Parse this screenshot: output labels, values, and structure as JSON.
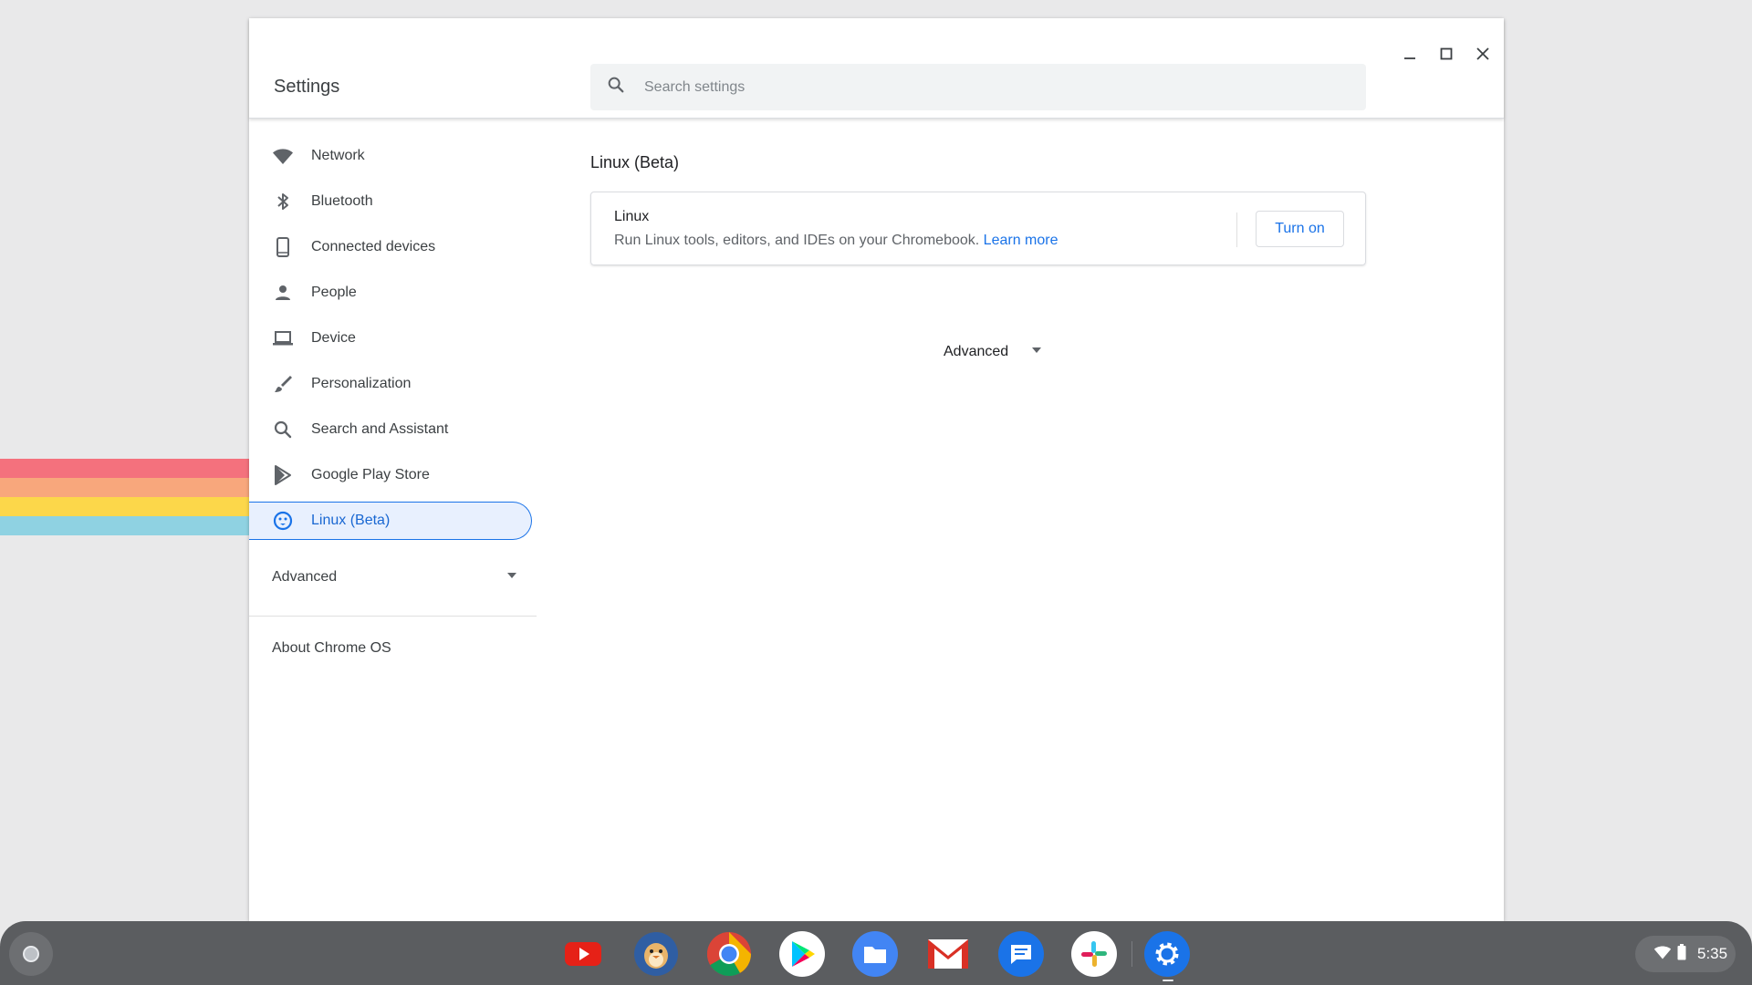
{
  "wallpaper": {
    "stripe_colors": [
      "#f4717d",
      "#f8a77c",
      "#fcd74a",
      "#8fd2e2"
    ]
  },
  "window": {
    "title": "Settings",
    "controls": {
      "minimize": "minimize-icon",
      "maximize": "maximize-icon",
      "close": "close-icon"
    }
  },
  "search": {
    "placeholder": "Search settings",
    "value": ""
  },
  "sidebar": {
    "items": [
      {
        "label": "Network",
        "icon": "wifi-icon"
      },
      {
        "label": "Bluetooth",
        "icon": "bluetooth-icon"
      },
      {
        "label": "Connected devices",
        "icon": "phone-icon"
      },
      {
        "label": "People",
        "icon": "person-icon"
      },
      {
        "label": "Device",
        "icon": "laptop-icon"
      },
      {
        "label": "Personalization",
        "icon": "brush-icon"
      },
      {
        "label": "Search and Assistant",
        "icon": "search-icon"
      },
      {
        "label": "Google Play Store",
        "icon": "play-store-icon"
      },
      {
        "label": "Linux (Beta)",
        "icon": "penguin-icon",
        "active": true
      }
    ],
    "advanced_label": "Advanced",
    "about_label": "About Chrome OS"
  },
  "main": {
    "title": "Linux (Beta)",
    "card": {
      "title": "Linux",
      "description": "Run Linux tools, editors, and IDEs on your Chromebook.",
      "learn_more": "Learn more",
      "button_label": "Turn on"
    },
    "advanced_label": "Advanced"
  },
  "shelf": {
    "apps": [
      {
        "name": "youtube-icon"
      },
      {
        "name": "penguin-app-icon"
      },
      {
        "name": "chrome-icon"
      },
      {
        "name": "play-store-icon"
      },
      {
        "name": "files-icon"
      },
      {
        "name": "gmail-icon"
      },
      {
        "name": "messages-icon"
      },
      {
        "name": "slack-icon"
      },
      {
        "name": "settings-icon",
        "active": true
      }
    ],
    "status": {
      "time": "5:35"
    }
  },
  "colors": {
    "accent": "#1a73e8",
    "active_bg": "#e8f0fe",
    "shelf": "#5b5d60"
  }
}
